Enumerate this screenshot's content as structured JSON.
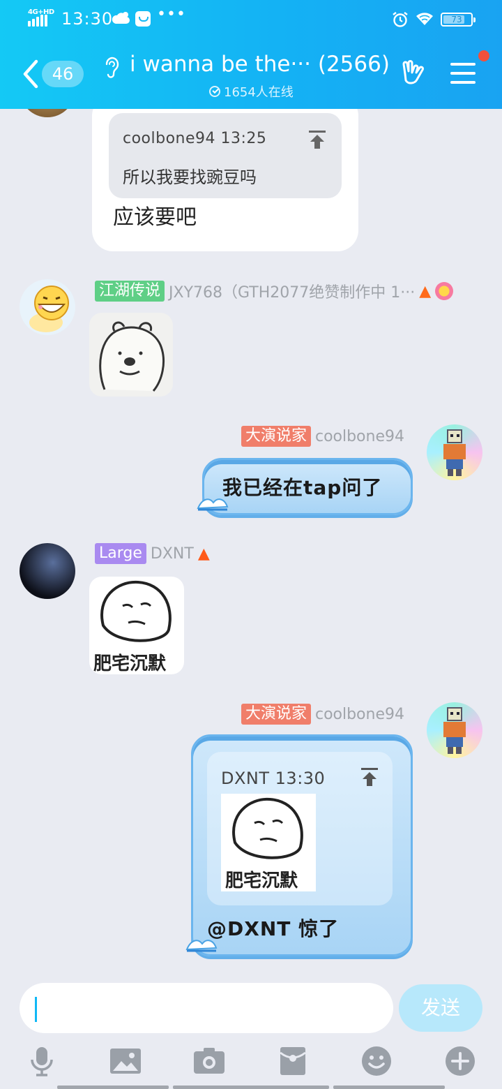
{
  "status_bar": {
    "network_type": "4G+HD",
    "time": "13:30",
    "overflow": "•••",
    "battery_level": "73"
  },
  "header": {
    "back_count": "46",
    "group_title": "i wanna be the··· (2566)",
    "online_count": "1654人在线"
  },
  "messages": [
    {
      "sender": "coolbone94",
      "quote": {
        "header": "coolbone94 13:25",
        "text": "所以我要找豌豆吗"
      },
      "text": "应该要吧"
    },
    {
      "tag": "江湖传说",
      "sender": "JXY768（GTH2077绝赞制作中 1···",
      "content": "sticker"
    },
    {
      "tag": "大演说家",
      "sender": "coolbone94",
      "text": "我已经在tap问了"
    },
    {
      "tag": "Large",
      "sender": "DXNT",
      "sticker_caption": "肥宅沉默"
    },
    {
      "tag": "大演说家",
      "sender": "coolbone94",
      "quote": {
        "header": "DXNT 13:30",
        "sticker_caption": "肥宅沉默"
      },
      "text": "@DXNT 惊了"
    }
  ],
  "input": {
    "value": "",
    "send_label": "发送"
  },
  "toolbar": [
    "voice",
    "image",
    "camera",
    "red-packet",
    "emoji",
    "more"
  ],
  "colors": {
    "header_gradient_start": "#14c9f5",
    "header_gradient_end": "#19a3f2",
    "tag_green": "#5fcf86",
    "tag_red": "#f07e6a",
    "tag_purple": "#a98af0",
    "send_button": "#b7e8fb"
  }
}
